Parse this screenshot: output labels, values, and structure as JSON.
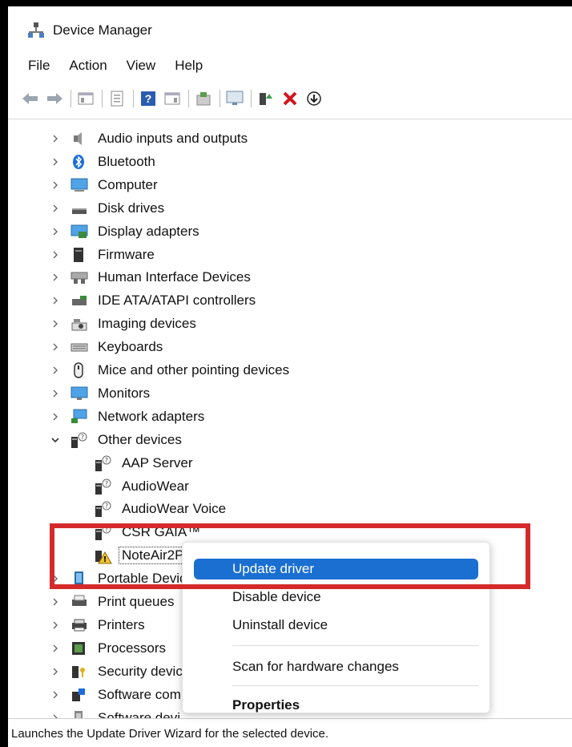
{
  "window": {
    "title": "Device Manager"
  },
  "menu": [
    "File",
    "Action",
    "View",
    "Help"
  ],
  "toolbar_icons": [
    "back-icon",
    "forward-icon",
    "show-hide-tree-icon",
    "properties-icon",
    "help-icon",
    "resources-icon",
    "update-driver-icon",
    "monitor-icon",
    "enable-device-icon",
    "uninstall-icon",
    "download-icon"
  ],
  "tree": {
    "items": [
      {
        "label": "Audio inputs and outputs",
        "icon": "speaker-icon",
        "expanded": false
      },
      {
        "label": "Bluetooth",
        "icon": "bluetooth-icon",
        "expanded": false
      },
      {
        "label": "Computer",
        "icon": "computer-icon",
        "expanded": false
      },
      {
        "label": "Disk drives",
        "icon": "disk-icon",
        "expanded": false
      },
      {
        "label": "Display adapters",
        "icon": "display-adapter-icon",
        "expanded": false
      },
      {
        "label": "Firmware",
        "icon": "firmware-icon",
        "expanded": false
      },
      {
        "label": "Human Interface Devices",
        "icon": "hid-icon",
        "expanded": false
      },
      {
        "label": "IDE ATA/ATAPI controllers",
        "icon": "ide-icon",
        "expanded": false
      },
      {
        "label": "Imaging devices",
        "icon": "camera-icon",
        "expanded": false
      },
      {
        "label": "Keyboards",
        "icon": "keyboard-icon",
        "expanded": false
      },
      {
        "label": "Mice and other pointing devices",
        "icon": "mouse-icon",
        "expanded": false
      },
      {
        "label": "Monitors",
        "icon": "monitor-icon",
        "expanded": false
      },
      {
        "label": "Network adapters",
        "icon": "network-icon",
        "expanded": false
      },
      {
        "label": "Other devices",
        "icon": "unknown-device-icon",
        "expanded": true
      },
      {
        "label": "AAP Server",
        "icon": "unknown-device-icon",
        "child": true
      },
      {
        "label": "AudioWear",
        "icon": "unknown-device-icon",
        "child": true
      },
      {
        "label": "AudioWear Voice",
        "icon": "unknown-device-icon",
        "child": true
      },
      {
        "label": "CSR GAIA™",
        "icon": "unknown-device-icon",
        "child": true
      },
      {
        "label": "NoteAir2P",
        "icon": "warning-device-icon",
        "child": true,
        "selected": true
      },
      {
        "label": "Portable Devic",
        "icon": "portable-device-icon",
        "expanded": false
      },
      {
        "label": "Print queues",
        "icon": "print-queue-icon",
        "expanded": false
      },
      {
        "label": "Printers",
        "icon": "printer-icon",
        "expanded": false
      },
      {
        "label": "Processors",
        "icon": "processor-icon",
        "expanded": false
      },
      {
        "label": "Security devic",
        "icon": "security-icon",
        "expanded": false
      },
      {
        "label": "Software com",
        "icon": "software-component-icon",
        "expanded": false
      },
      {
        "label": "Software devi",
        "icon": "software-device-icon",
        "expanded": false
      }
    ]
  },
  "context_menu": {
    "items": [
      {
        "label": "Update driver",
        "highlighted": true
      },
      {
        "label": "Disable device"
      },
      {
        "label": "Uninstall device"
      },
      {
        "label": "Scan for hardware changes"
      },
      {
        "label": "Properties",
        "bold": true
      }
    ]
  },
  "status_bar": {
    "text": "Launches the Update Driver Wizard for the selected device."
  },
  "colors": {
    "highlight": "#1a6fd1",
    "annotation": "#d42a2a"
  }
}
